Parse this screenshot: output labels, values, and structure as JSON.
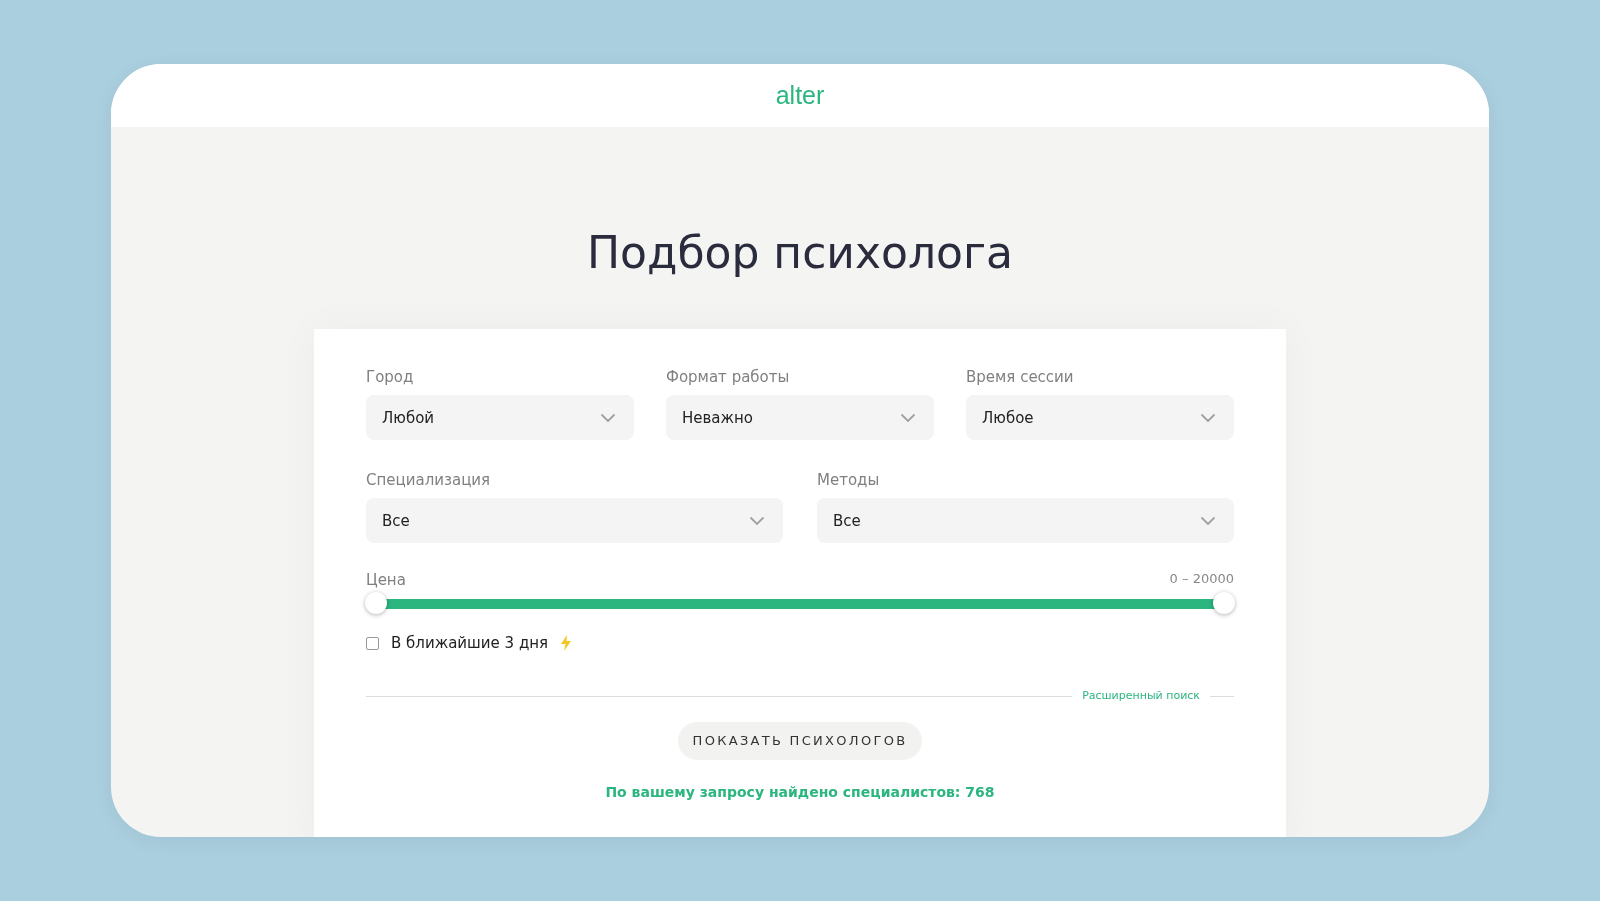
{
  "header": {
    "logo": "alter"
  },
  "title": "Подбор психолога",
  "filter_rows": [
    [
      {
        "label": "Город",
        "value": "Любой"
      },
      {
        "label": "Формат работы",
        "value": "Неважно"
      },
      {
        "label": "Время сессии",
        "value": "Любое"
      }
    ],
    [
      {
        "label": "Специализация",
        "value": "Все"
      },
      {
        "label": "Методы",
        "value": "Все"
      }
    ]
  ],
  "price": {
    "label": "Цена",
    "reading": "0 – 20000",
    "handles": [
      {
        "level": 0
      },
      {
        "level": 1
      }
    ]
  },
  "soon": {
    "label": "В ближайшие 3 дня",
    "checked": false
  },
  "advanced_link": "Расширенный поиск",
  "submit": "ПОКАЗАТЬ ПСИХОЛОГОВ",
  "result": "По вашему запросу найдено специалистов: 768"
}
